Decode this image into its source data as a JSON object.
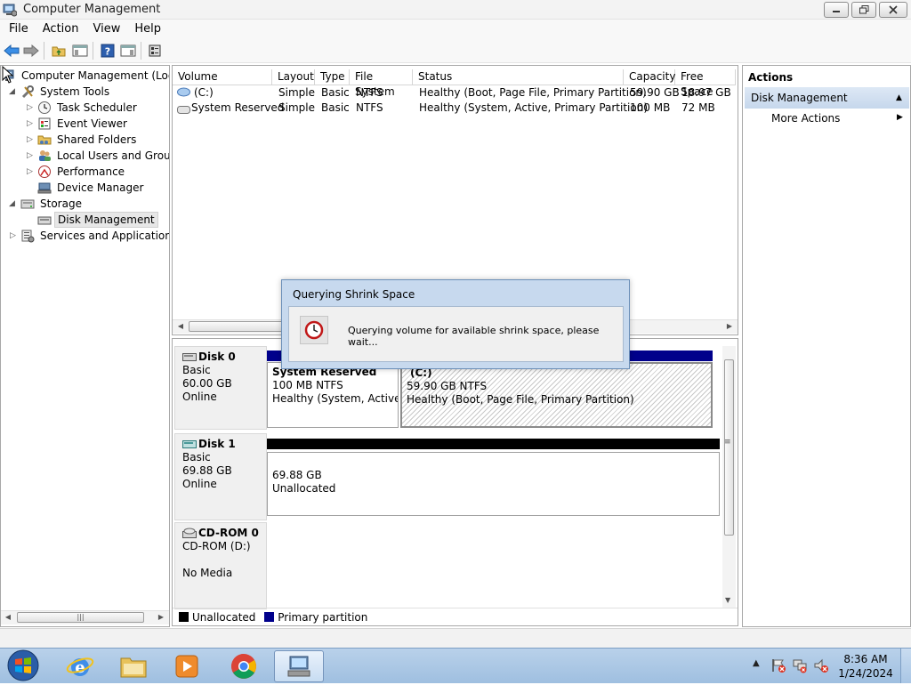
{
  "window": {
    "title": "Computer Management"
  },
  "menu": [
    "File",
    "Action",
    "View",
    "Help"
  ],
  "tree": {
    "root": "Computer Management (Local",
    "system_tools": "System Tools",
    "task_scheduler": "Task Scheduler",
    "event_viewer": "Event Viewer",
    "shared_folders": "Shared Folders",
    "local_users": "Local Users and Groups",
    "performance": "Performance",
    "device_manager": "Device Manager",
    "storage": "Storage",
    "disk_management": "Disk Management",
    "services": "Services and Applications"
  },
  "volumes": {
    "headers": [
      "Volume",
      "Layout",
      "Type",
      "File System",
      "Status",
      "Capacity",
      "Free Space"
    ],
    "rows": [
      [
        "(C:)",
        "Simple",
        "Basic",
        "NTFS",
        "Healthy (Boot, Page File, Primary Partition)",
        "59.90 GB",
        "18.97 GB"
      ],
      [
        "System Reserved",
        "Simple",
        "Basic",
        "NTFS",
        "Healthy (System, Active, Primary Partition)",
        "100 MB",
        "72 MB"
      ]
    ]
  },
  "disks": {
    "disk0": {
      "name": "Disk 0",
      "type": "Basic",
      "size": "60.00 GB",
      "status": "Online"
    },
    "disk0_p1": {
      "name": "System Reserved",
      "fs": "100 MB NTFS",
      "status": "Healthy (System, Active,"
    },
    "disk0_p2": {
      "name": "(C:)",
      "fs": "59.90 GB NTFS",
      "status": "Healthy (Boot, Page File, Primary Partition)"
    },
    "disk1": {
      "name": "Disk 1",
      "type": "Basic",
      "size": "69.88 GB",
      "status": "Online"
    },
    "disk1_p1": {
      "size": "69.88 GB",
      "status": "Unallocated"
    },
    "cdrom": {
      "name": "CD-ROM 0",
      "drive": "CD-ROM (D:)",
      "status": "No Media"
    }
  },
  "legend": {
    "unallocated": "Unallocated",
    "primary": "Primary partition"
  },
  "actions": {
    "title": "Actions",
    "section": "Disk Management",
    "more": "More Actions"
  },
  "dialog": {
    "title": "Querying Shrink Space",
    "message": "Querying volume for available shrink space, please wait..."
  },
  "clock": {
    "time": "8:36 AM",
    "date": "1/24/2024"
  },
  "colors": {
    "primary_partition": "#00008b",
    "unallocated": "#000000",
    "actions_highlight": "#c6d7ec",
    "taskbar": "#b9d1ea"
  }
}
